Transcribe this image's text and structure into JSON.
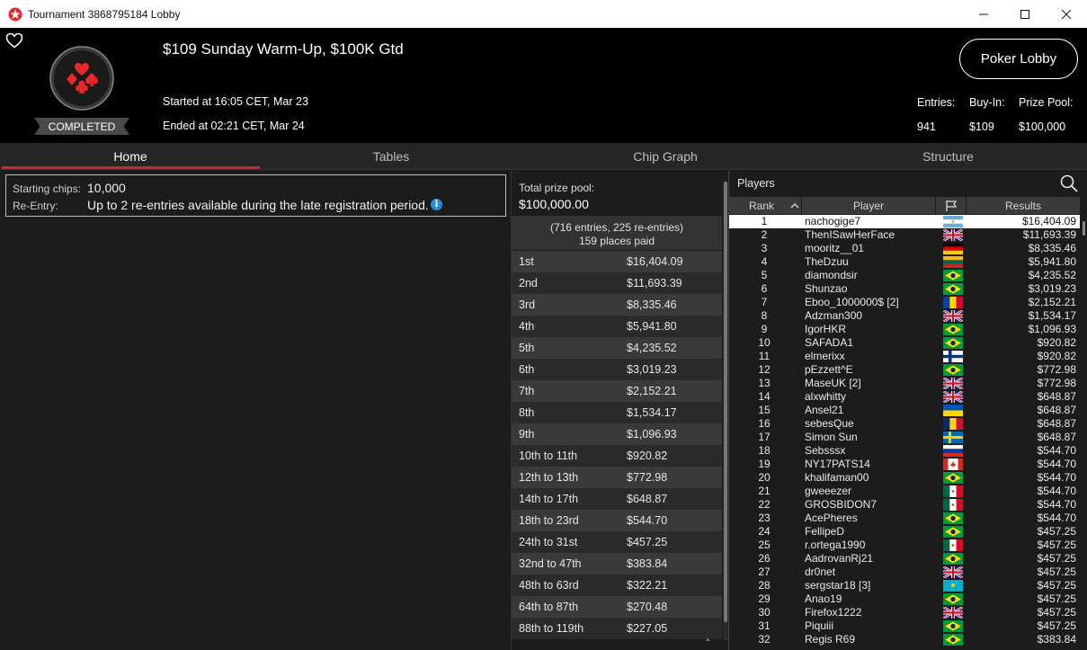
{
  "window": {
    "title": "Tournament 3868795184 Lobby"
  },
  "header": {
    "tournament_name": "$109 Sunday Warm-Up, $100K Gtd",
    "status": "COMPLETED",
    "started": "Started at 16:05 CET, Mar 23",
    "ended": "Ended at 02:21 CET, Mar 24",
    "poker_lobby_label": "Poker Lobby",
    "stats": [
      {
        "label": "Entries:",
        "value": "941"
      },
      {
        "label": "Buy-In:",
        "value": "$109"
      },
      {
        "label": "Prize Pool:",
        "value": "$100,000"
      }
    ]
  },
  "tabs": [
    {
      "label": "Home",
      "active": true
    },
    {
      "label": "Tables",
      "active": false
    },
    {
      "label": "Chip Graph",
      "active": false
    },
    {
      "label": "Structure",
      "active": false
    }
  ],
  "home": {
    "starting_chips_label": "Starting chips:",
    "starting_chips_value": "10,000",
    "reentry_label": "Re-Entry:",
    "reentry_value": "Up to 2 re-entries available during the late registration period."
  },
  "prizes": {
    "total_label": "Total prize pool:",
    "total_value": "$100,000.00",
    "entries_text": "(716 entries, 225 re-entries)",
    "places_paid": "159 places paid",
    "rows": [
      {
        "place": "1st",
        "amount": "$16,404.09"
      },
      {
        "place": "2nd",
        "amount": "$11,693.39"
      },
      {
        "place": "3rd",
        "amount": "$8,335.46"
      },
      {
        "place": "4th",
        "amount": "$5,941.80"
      },
      {
        "place": "5th",
        "amount": "$4,235.52"
      },
      {
        "place": "6th",
        "amount": "$3,019.23"
      },
      {
        "place": "7th",
        "amount": "$2,152.21"
      },
      {
        "place": "8th",
        "amount": "$1,534.17"
      },
      {
        "place": "9th",
        "amount": "$1,096.93"
      },
      {
        "place": "10th to 11th",
        "amount": "$920.82"
      },
      {
        "place": "12th to 13th",
        "amount": "$772.98"
      },
      {
        "place": "14th to 17th",
        "amount": "$648.87"
      },
      {
        "place": "18th to 23rd",
        "amount": "$544.70"
      },
      {
        "place": "24th to 31st",
        "amount": "$457.25"
      },
      {
        "place": "32nd to 47th",
        "amount": "$383.84"
      },
      {
        "place": "48th to 63rd",
        "amount": "$322.21"
      },
      {
        "place": "64th to 87th",
        "amount": "$270.48"
      },
      {
        "place": "88th to 119th",
        "amount": "$227.05"
      }
    ]
  },
  "players": {
    "title": "Players",
    "columns": {
      "rank": "Rank",
      "player": "Player",
      "results": "Results"
    },
    "rows": [
      {
        "rank": "1",
        "name": "nachogige7",
        "flag": "argentina",
        "result": "$16,404.09"
      },
      {
        "rank": "2",
        "name": "ThenISawHerFace",
        "flag": "uk",
        "result": "$11,693.39"
      },
      {
        "rank": "3",
        "name": "mooritz__01",
        "flag": "germany",
        "result": "$8,335.46"
      },
      {
        "rank": "4",
        "name": "TheDzuu",
        "flag": "lithuania",
        "result": "$5,941.80"
      },
      {
        "rank": "5",
        "name": "diamondsir",
        "flag": "brazil",
        "result": "$4,235.52"
      },
      {
        "rank": "6",
        "name": "Shunzao",
        "flag": "brazil",
        "result": "$3,019.23"
      },
      {
        "rank": "7",
        "name": "Eboo_1000000$ [2]",
        "flag": "moldova",
        "result": "$2,152.21"
      },
      {
        "rank": "8",
        "name": "Adzman300",
        "flag": "uk",
        "result": "$1,534.17"
      },
      {
        "rank": "9",
        "name": "IgorHKR",
        "flag": "brazil",
        "result": "$1,096.93"
      },
      {
        "rank": "10",
        "name": "SAFADA1",
        "flag": "brazil",
        "result": "$920.82"
      },
      {
        "rank": "11",
        "name": "elmerixx",
        "flag": "finland",
        "result": "$920.82"
      },
      {
        "rank": "12",
        "name": "pEzzett^E",
        "flag": "brazil",
        "result": "$772.98"
      },
      {
        "rank": "13",
        "name": "MaseUK [2]",
        "flag": "uk",
        "result": "$772.98"
      },
      {
        "rank": "14",
        "name": "alxwhitty",
        "flag": "uk",
        "result": "$648.87"
      },
      {
        "rank": "15",
        "name": "Ansel21",
        "flag": "ukraine",
        "result": "$648.87"
      },
      {
        "rank": "16",
        "name": "sebesQue",
        "flag": "romania",
        "result": "$648.87"
      },
      {
        "rank": "17",
        "name": "Simon Sun",
        "flag": "sweden",
        "result": "$648.87"
      },
      {
        "rank": "18",
        "name": "Sebsssx",
        "flag": "russia",
        "result": "$544.70"
      },
      {
        "rank": "19",
        "name": "NY17PATS14",
        "flag": "canada",
        "result": "$544.70"
      },
      {
        "rank": "20",
        "name": "khalifaman00",
        "flag": "brazil",
        "result": "$544.70"
      },
      {
        "rank": "21",
        "name": "gweeezer",
        "flag": "mexico",
        "result": "$544.70"
      },
      {
        "rank": "22",
        "name": "GROSBIDON7",
        "flag": "mexico",
        "result": "$544.70"
      },
      {
        "rank": "23",
        "name": "AcePheres",
        "flag": "brazil",
        "result": "$544.70"
      },
      {
        "rank": "24",
        "name": "FellipeD",
        "flag": "brazil",
        "result": "$457.25"
      },
      {
        "rank": "25",
        "name": "r.ortega1990",
        "flag": "mexico",
        "result": "$457.25"
      },
      {
        "rank": "26",
        "name": "AadrovanRj21",
        "flag": "brazil",
        "result": "$457.25"
      },
      {
        "rank": "27",
        "name": "dr0net",
        "flag": "uk",
        "result": "$457.25"
      },
      {
        "rank": "28",
        "name": "sergstar18 [3]",
        "flag": "kazakhstan",
        "result": "$457.25"
      },
      {
        "rank": "29",
        "name": "Anao19",
        "flag": "brazil",
        "result": "$457.25"
      },
      {
        "rank": "30",
        "name": "Firefox1222",
        "flag": "uk",
        "result": "$457.25"
      },
      {
        "rank": "31",
        "name": "Piquiii",
        "flag": "brazil",
        "result": "$457.25"
      },
      {
        "rank": "32",
        "name": "Regis R69",
        "flag": "brazil",
        "result": "$383.84"
      }
    ]
  },
  "colors": {
    "accent": "#d6242f",
    "brand_red": "#e8262c",
    "info_blue": "#2a8ad6"
  }
}
